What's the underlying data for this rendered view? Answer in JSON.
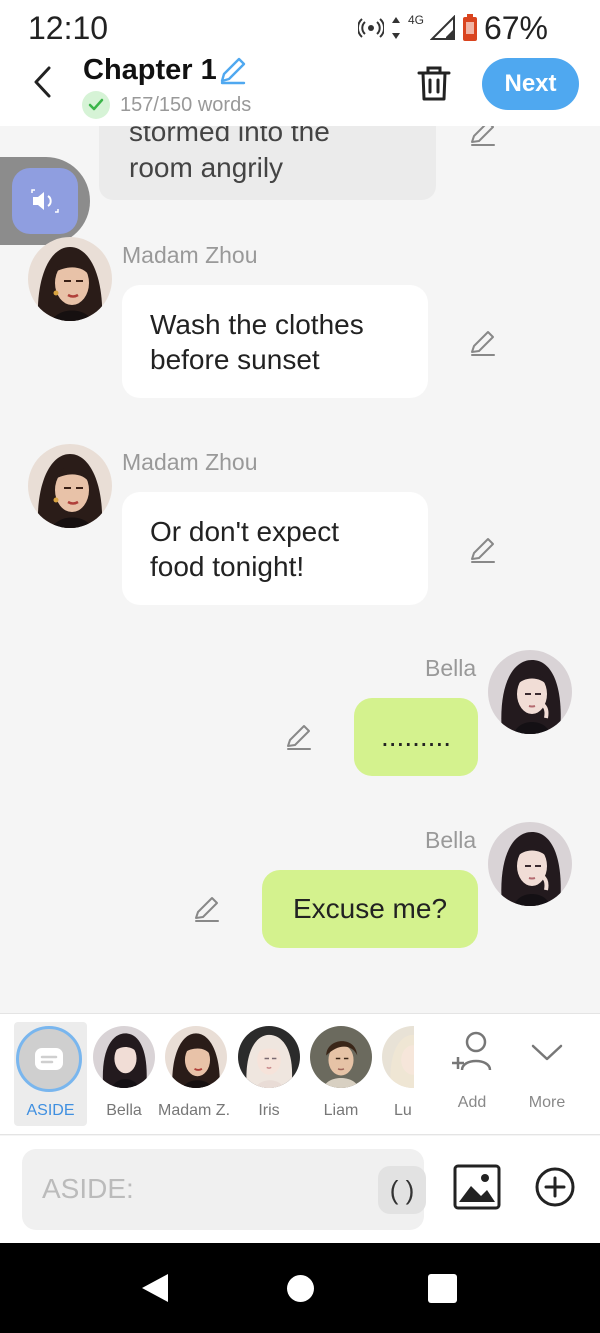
{
  "status_bar": {
    "time": "12:10",
    "network": "4G",
    "battery": "67%"
  },
  "header": {
    "title": "Chapter 1",
    "word_count": "157/150 words",
    "next_label": "Next"
  },
  "chat": {
    "narration": {
      "line1": "stormed into the",
      "line2": "room angrily"
    },
    "messages": [
      {
        "speaker": "Madam Zhou",
        "line1": "Wash the clothes",
        "line2": "before sunset"
      },
      {
        "speaker": "Madam Zhou",
        "line1": "Or don't expect",
        "line2": "food tonight!"
      },
      {
        "speaker": "Bella",
        "text": "........."
      },
      {
        "speaker": "Bella",
        "text": "Excuse me?"
      }
    ]
  },
  "character_bar": {
    "aside_label": "ASIDE",
    "characters": [
      "Bella",
      "Madam Z...",
      "Iris",
      "Liam",
      "Lu"
    ],
    "add_label": "Add",
    "more_label": "More"
  },
  "input": {
    "placeholder": "ASIDE:",
    "paren_label": "( )"
  },
  "colors": {
    "accent": "#4fa8f0",
    "bubble_right": "#d4f28e",
    "bubble_left": "#ffffff",
    "aside_active": "#3f8fe0"
  }
}
